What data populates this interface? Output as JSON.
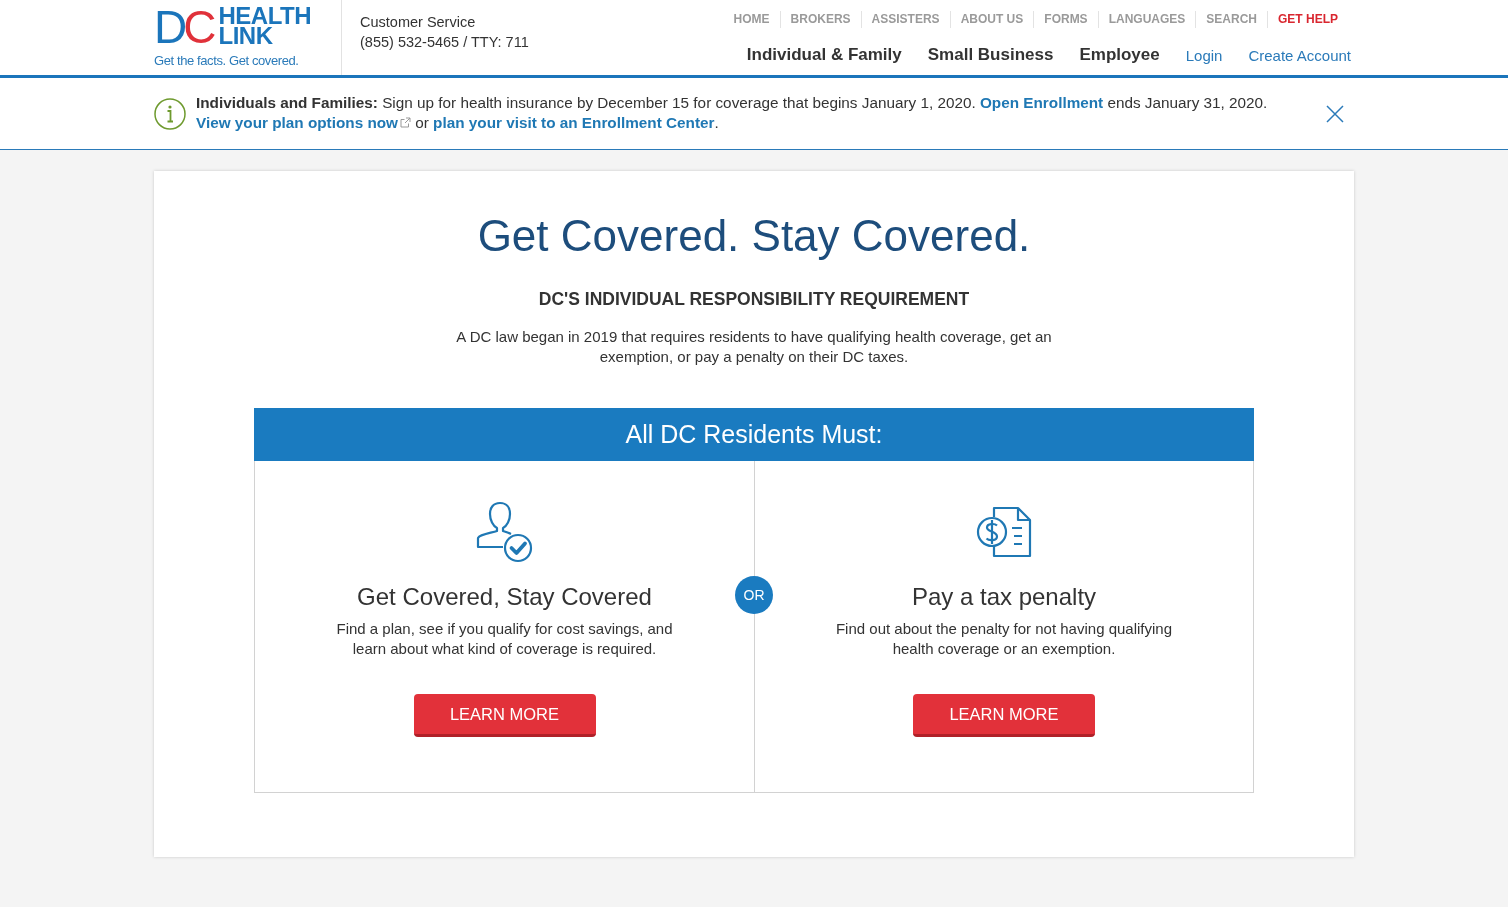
{
  "header": {
    "logo": {
      "mark": "DC",
      "name_lines": [
        "HEALTH",
        "LINK"
      ],
      "tagline": "Get the facts. Get covered."
    },
    "customer_service": {
      "title": "Customer Service",
      "phone": "(855) 532-5465 / TTY: 711"
    },
    "top_links": [
      {
        "label": "HOME",
        "emphasis": false
      },
      {
        "label": "BROKERS",
        "emphasis": false
      },
      {
        "label": "ASSISTERS",
        "emphasis": false
      },
      {
        "label": "ABOUT US",
        "emphasis": false
      },
      {
        "label": "FORMS",
        "emphasis": false
      },
      {
        "label": "LANGUAGES",
        "emphasis": false
      },
      {
        "label": "SEARCH",
        "emphasis": false
      },
      {
        "label": "GET HELP",
        "emphasis": true
      }
    ],
    "main_nav": [
      "Individual & Family",
      "Small Business",
      "Employee"
    ],
    "account_links": [
      "Login",
      "Create Account"
    ]
  },
  "alert": {
    "lines": [
      {
        "segments": [
          {
            "kind": "strong",
            "text": "Individuals and Families:"
          },
          {
            "kind": "text",
            "text": " Sign up for health insurance by December 15 for coverage that begins January 1, 2020. "
          },
          {
            "kind": "link",
            "text": "Open Enrollment",
            "external": false
          },
          {
            "kind": "text",
            "text": " ends January 31, 2020."
          }
        ]
      },
      {
        "segments": [
          {
            "kind": "link",
            "text": "View your plan options now",
            "external": true
          },
          {
            "kind": "text",
            "text": " or "
          },
          {
            "kind": "link",
            "text": "plan your visit to an Enrollment Center",
            "external": false
          },
          {
            "kind": "text",
            "text": "."
          }
        ]
      }
    ]
  },
  "page": {
    "title": "Get Covered. Stay Covered.",
    "subtitle": "DC'S INDIVIDUAL RESPONSIBILITY REQUIREMENT",
    "intro": "A DC law began in 2019 that requires residents to have qualifying health coverage, get an exemption, or pay a penalty on their DC taxes.",
    "banner": "All DC Residents Must:",
    "options": [
      {
        "title": "Get Covered, Stay Covered",
        "description": "Find a plan, see if you qualify for cost savings, and learn about what kind of coverage is required.",
        "button": "LEARN MORE"
      },
      {
        "title": "Pay a tax penalty",
        "description": "Find out about the penalty for not having qualifying health coverage or an exemption.",
        "button": "LEARN MORE"
      }
    ],
    "separator": "OR"
  }
}
